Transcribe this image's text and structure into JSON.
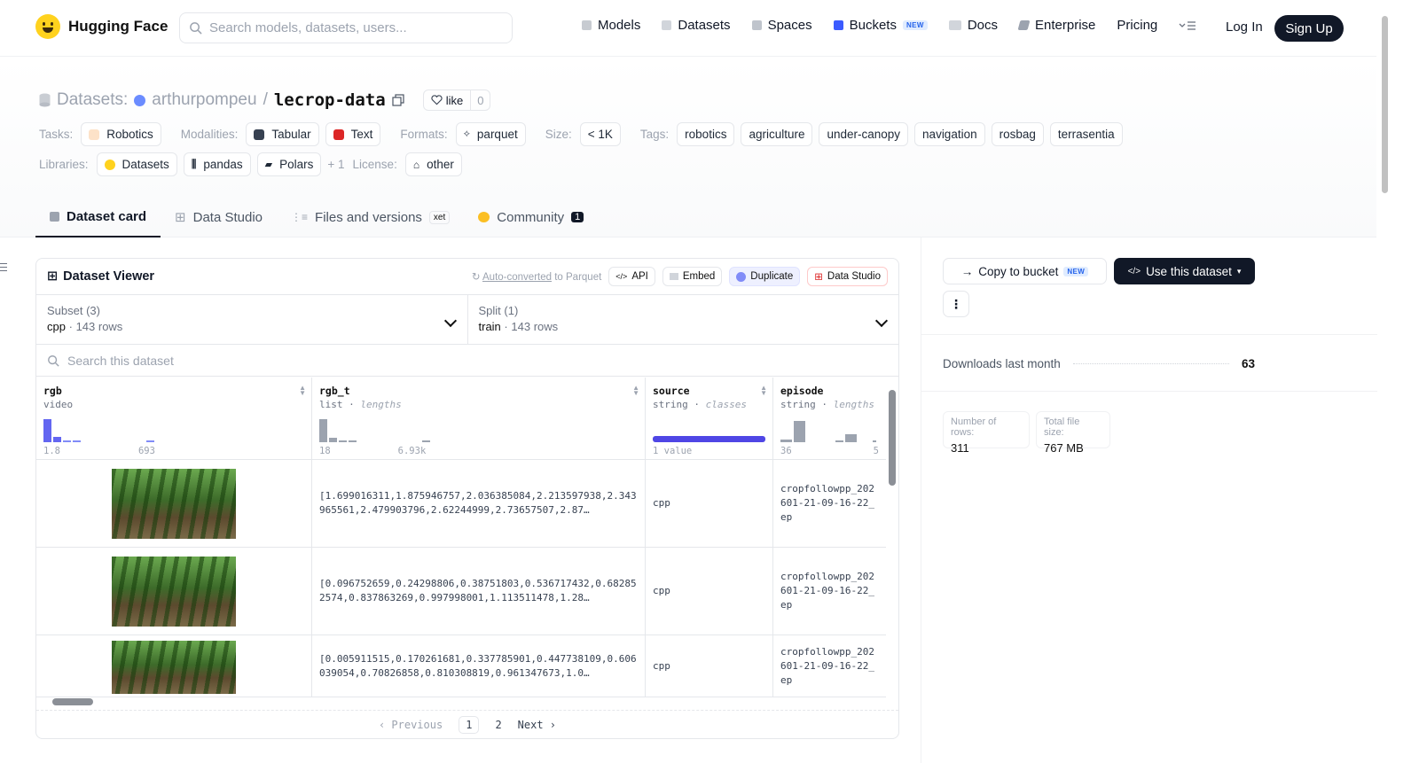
{
  "brand": {
    "name": "Hugging Face"
  },
  "search": {
    "placeholder": "Search models, datasets, users..."
  },
  "nav": {
    "items": [
      "Models",
      "Datasets",
      "Spaces",
      "Buckets",
      "Docs",
      "Enterprise",
      "Pricing"
    ],
    "new_badge": "NEW",
    "login": "Log In",
    "signup": "Sign Up"
  },
  "header": {
    "prefix": "Datasets:",
    "owner": "arthurpompeu",
    "separator": "/",
    "repo": "lecrop-data",
    "like_label": "like",
    "like_count": "0"
  },
  "tags": {
    "tasks_label": "Tasks:",
    "tasks": [
      "Robotics"
    ],
    "modalities_label": "Modalities:",
    "modalities": [
      "Tabular",
      "Text"
    ],
    "formats_label": "Formats:",
    "formats": [
      "parquet"
    ],
    "size_label": "Size:",
    "size": "< 1K",
    "tags_label": "Tags:",
    "tags": [
      "robotics",
      "agriculture",
      "under-canopy",
      "navigation",
      "rosbag",
      "terrasentia"
    ],
    "libraries_label": "Libraries:",
    "libraries": [
      "Datasets",
      "pandas",
      "Polars"
    ],
    "libraries_more": "+ 1",
    "license_label": "License:",
    "license": "other"
  },
  "tabs": {
    "card": "Dataset card",
    "studio": "Data Studio",
    "files": "Files and versions",
    "xet": "xet",
    "community": "Community",
    "community_count": "1"
  },
  "viewer": {
    "title": "Dataset Viewer",
    "autoconv_link": "Auto-converted",
    "autoconv_rest": "to Parquet",
    "api": "API",
    "embed": "Embed",
    "duplicate": "Duplicate",
    "data_studio": "Data Studio",
    "subset_label": "Subset (3)",
    "subset_value": "cpp",
    "subset_rows": "143 rows",
    "split_label": "Split (1)",
    "split_value": "train",
    "split_rows": "143 rows",
    "search_placeholder": "Search this dataset",
    "columns": [
      {
        "name": "rgb",
        "type": "video",
        "stat": "",
        "min": "1.8",
        "max": "693"
      },
      {
        "name": "rgb_t",
        "type": "list",
        "stat": "lengths",
        "min": "18",
        "max": "6.93k"
      },
      {
        "name": "source",
        "type": "string",
        "stat": "classes",
        "min": "1 value",
        "max": ""
      },
      {
        "name": "episode",
        "type": "string",
        "stat": "lengths",
        "min": "36",
        "max": "5"
      }
    ],
    "rows": [
      {
        "rgb_t": "[1.699016311,1.875946757,2.036385084,2.213597938,2.343965561,2.479903796,2.62244999,2.73657507,2.87…",
        "source": "cpp",
        "episode": "cropfollowpp_202601-21-09-16-22_ep"
      },
      {
        "rgb_t": "[0.096752659,0.24298806,0.38751803,0.536717432,0.682852574,0.837863269,0.997998001,1.113511478,1.28…",
        "source": "cpp",
        "episode": "cropfollowpp_202601-21-09-16-22_ep"
      },
      {
        "rgb_t": "[0.005911515,0.170261681,0.337785901,0.447738109,0.606039054,0.70826858,0.810308819,0.961347673,1.0…",
        "source": "cpp",
        "episode": "cropfollowpp_202601-21-09-16-22_ep"
      }
    ],
    "pager": {
      "prev": "Previous",
      "pages": [
        "1",
        "2"
      ],
      "next": "Next"
    }
  },
  "sidebar": {
    "copy_bucket": "Copy to bucket",
    "use_dataset": "Use this dataset",
    "downloads_label": "Downloads last month",
    "downloads_value": "63",
    "rows_label": "Number of rows:",
    "rows_value": "311",
    "size_label": "Total file size:",
    "size_value": "767 MB"
  }
}
